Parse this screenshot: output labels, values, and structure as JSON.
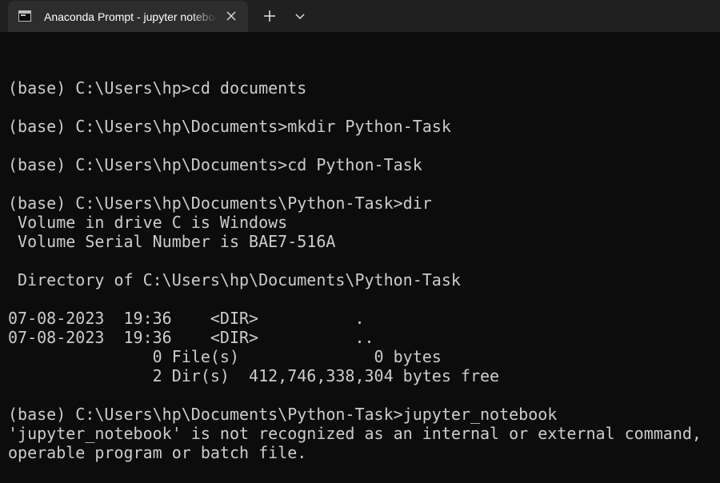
{
  "tab": {
    "title": "Anaconda Prompt - jupyter  notebook",
    "icon": "terminal-icon"
  },
  "controls": {
    "close_icon": "close-icon",
    "new_tab_icon": "plus-icon",
    "dropdown_icon": "chevron-down-icon"
  },
  "colors": {
    "background": "#0c0c0c",
    "text": "#cccccc",
    "tabbar": "#202020",
    "active_tab": "#2d2d2d"
  },
  "console": {
    "lines": [
      "",
      "(base) C:\\Users\\hp>cd documents",
      "",
      "(base) C:\\Users\\hp\\Documents>mkdir Python-Task",
      "",
      "(base) C:\\Users\\hp\\Documents>cd Python-Task",
      "",
      "(base) C:\\Users\\hp\\Documents\\Python-Task>dir",
      " Volume in drive C is Windows",
      " Volume Serial Number is BAE7-516A",
      "",
      " Directory of C:\\Users\\hp\\Documents\\Python-Task",
      "",
      "07-08-2023  19:36    <DIR>          .",
      "07-08-2023  19:36    <DIR>          ..",
      "               0 File(s)              0 bytes",
      "               2 Dir(s)  412,746,338,304 bytes free",
      "",
      "(base) C:\\Users\\hp\\Documents\\Python-Task>jupyter_notebook",
      "'jupyter_notebook' is not recognized as an internal or external command,",
      "operable program or batch file.",
      ""
    ],
    "last_prompt": "(base) C:\\Users\\hp\\Documents\\Python-Task>jupyter",
    "last_input_tail": " notebook"
  }
}
